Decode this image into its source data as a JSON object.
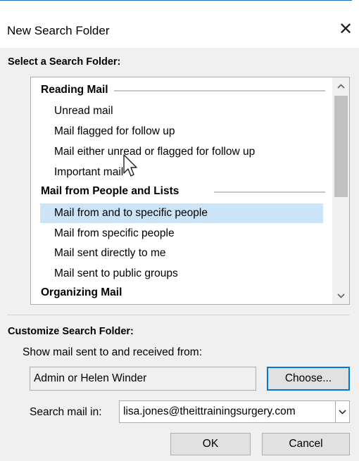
{
  "dialog": {
    "title": "New Search Folder"
  },
  "icons": {
    "close": "close-icon",
    "scroll_up": "chevron-up-icon",
    "scroll_down": "chevron-down-icon",
    "combo": "chevron-down-icon",
    "cursor": "mouse-pointer-icon"
  },
  "select_section": {
    "label": "Select a Search Folder:"
  },
  "folder_list": {
    "groups": [
      {
        "header": "Reading Mail",
        "items": [
          "Unread mail",
          "Mail flagged for follow up",
          "Mail either unread or flagged for follow up",
          "Important mail"
        ]
      },
      {
        "header": "Mail from People and Lists",
        "items": [
          "Mail from and to specific people",
          "Mail from specific people",
          "Mail sent directly to me",
          "Mail sent to public groups"
        ]
      },
      {
        "header": "Organizing Mail",
        "items": []
      }
    ],
    "selected_item": "Mail from and to specific people"
  },
  "customize": {
    "label": "Customize Search Folder:",
    "show_mail_label": "Show mail sent to and received from:",
    "people_value": "Admin or Helen Winder",
    "choose_button": "Choose...",
    "search_in_label": "Search mail in:",
    "search_in_value": "lisa.jones@theittrainingsurgery.com"
  },
  "buttons": {
    "ok": "OK",
    "cancel": "Cancel"
  },
  "colors": {
    "accent": "#0078d7",
    "selection": "#cce4f7",
    "dialog_bg": "#f0f0f0"
  }
}
